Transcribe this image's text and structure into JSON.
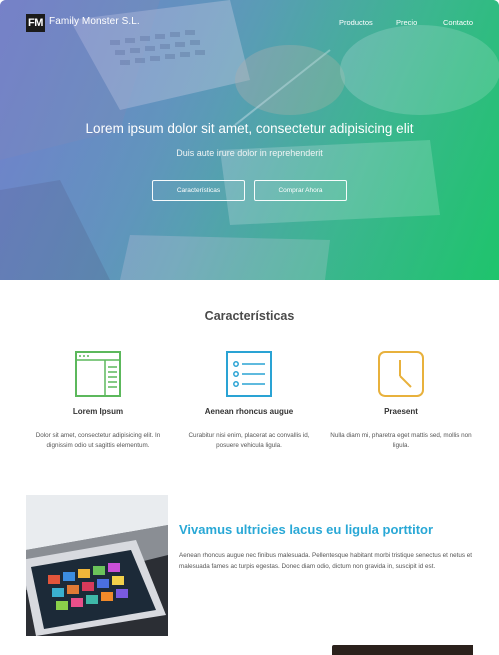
{
  "nav": {
    "logo_mark": "FM",
    "brand": "Family Monster S.L.",
    "links": [
      "Productos",
      "Precio",
      "Contacto"
    ]
  },
  "hero": {
    "title": "Lorem ipsum dolor sit amet, consectetur adipisicing elit",
    "subtitle": "Duis aute irure dolor in reprehenderit",
    "buttons": [
      "Características",
      "Comprar Ahora"
    ]
  },
  "features": {
    "title": "Características",
    "items": [
      {
        "icon": "browser-window-icon",
        "color": "#5cb85c",
        "title": "Lorem Ipsum",
        "text": "Dolor sit amet, consectetur adipisicing elit. In dignissim odio ut sagittis elementum."
      },
      {
        "icon": "list-icon",
        "color": "#2aa3d4",
        "title": "Aenean rhoncus augue",
        "text": "Curabitur nisi enim, placerat ac convallis id, posuere vehicula ligula."
      },
      {
        "icon": "clock-icon",
        "color": "#e8b13c",
        "title": "Praesent",
        "text": "Nulla diam mi, pharetra eget mattis sed, mollis non ligula."
      }
    ]
  },
  "section2": {
    "title": "Vivamus ultricies lacus eu ligula porttitor",
    "text": "Aenean rhoncus augue nec finibus malesuada. Pellentesque habitant morbi tristique senectus et netus et malesuada fames ac turpis egestas. Donec diam odio, dictum non gravida in, suscipit id est."
  },
  "colors": {
    "accent": "#29a8d6",
    "hero_left": "#6f86c9",
    "hero_right": "#1fbf6a"
  }
}
